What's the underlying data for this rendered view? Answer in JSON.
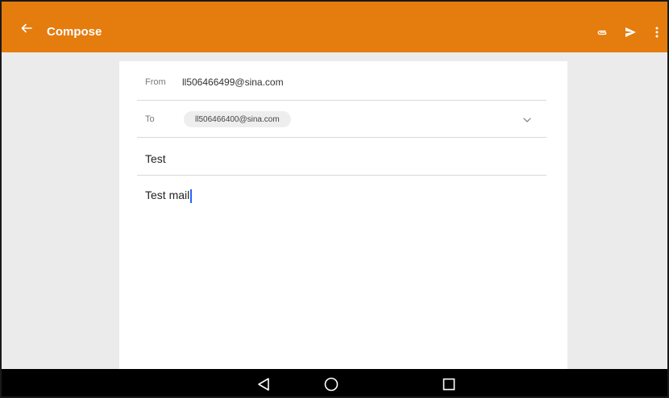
{
  "colors": {
    "appbar": "#e57c0e",
    "background": "#ebebeb",
    "card": "#ffffff",
    "navbar": "#000000",
    "caret": "#2962ff"
  },
  "appbar": {
    "back_icon": "arrow-left-icon",
    "title": "Compose",
    "actions": [
      {
        "icon": "paperclip-icon",
        "label": "Attach"
      },
      {
        "icon": "send-icon",
        "label": "Send"
      },
      {
        "icon": "more-vert-icon",
        "label": "More options"
      }
    ]
  },
  "compose": {
    "from_label": "From",
    "from_value": "ll506466499@sina.com",
    "to_label": "To",
    "to_chip": "ll506466400@sina.com",
    "to_expand_icon": "chevron-down-icon",
    "subject": "Test",
    "body": "Test mail"
  },
  "navbar": {
    "buttons": [
      {
        "icon": "back-triangle-icon"
      },
      {
        "icon": "home-circle-icon"
      },
      {
        "icon": "recents-square-icon"
      }
    ]
  }
}
